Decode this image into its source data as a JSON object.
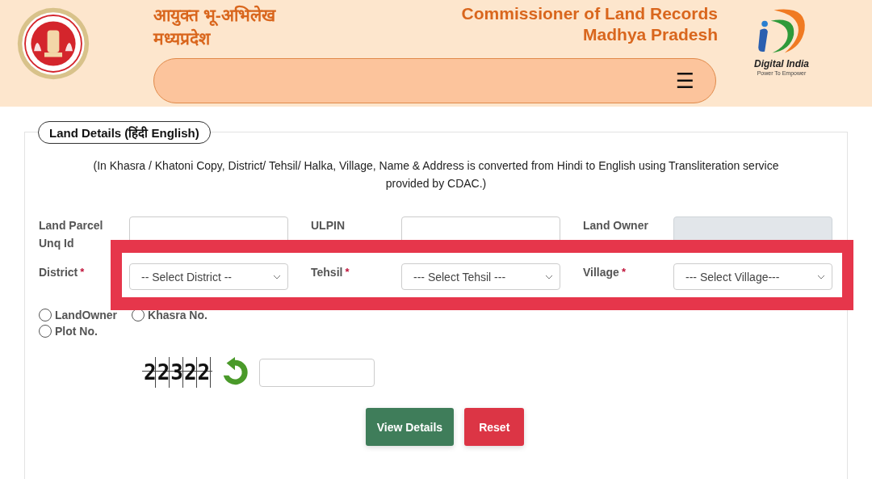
{
  "header": {
    "title_hindi_line1": "आयुक्त भू-अभिलेख",
    "title_hindi_line2": "मध्यप्रदेश",
    "title_english_line1": "Commissioner of Land Records",
    "title_english_line2": "Madhya Pradesh",
    "logo_name": "Digital India",
    "logo_tagline": "Power To Empower",
    "menu_icon": "☰"
  },
  "panel": {
    "legend": "Land Details  (हिंदी   English)",
    "note": "(In Khasra / Khatoni Copy, District/ Tehsil/ Halka, Village, Name & Address is converted from Hindi to English using Transliteration service provided by CDAC.)"
  },
  "fields": [
    [
      {
        "label": "Land Parcel Unq Id",
        "kind": "text",
        "disabled": false
      },
      {
        "label": "ULPIN",
        "kind": "text",
        "disabled": false
      },
      {
        "label": "Land Owner",
        "kind": "text",
        "disabled": true
      }
    ],
    [
      {
        "label": "District",
        "kind": "select",
        "required_mark": "*",
        "value": "-- Select District --",
        "disabled": false
      },
      {
        "label": "Tehsil",
        "kind": "select",
        "required_mark": "*",
        "value": "--- Select Tehsil ---",
        "disabled": false
      },
      {
        "label": "Village",
        "kind": "select",
        "required_mark": "*",
        "value": "--- Select Village---",
        "disabled": false
      }
    ]
  ],
  "search_by": [
    {
      "label": "LandOwner",
      "selected": false
    },
    {
      "label": "Khasra No.",
      "selected": false
    },
    {
      "label": "Plot No.",
      "selected": false
    }
  ],
  "captcha": {
    "code": "22322"
  },
  "buttons": [
    {
      "label": "View Details",
      "kind": "primary"
    },
    {
      "label": "Reset",
      "kind": "danger"
    }
  ],
  "highlight": {
    "shown": true
  }
}
